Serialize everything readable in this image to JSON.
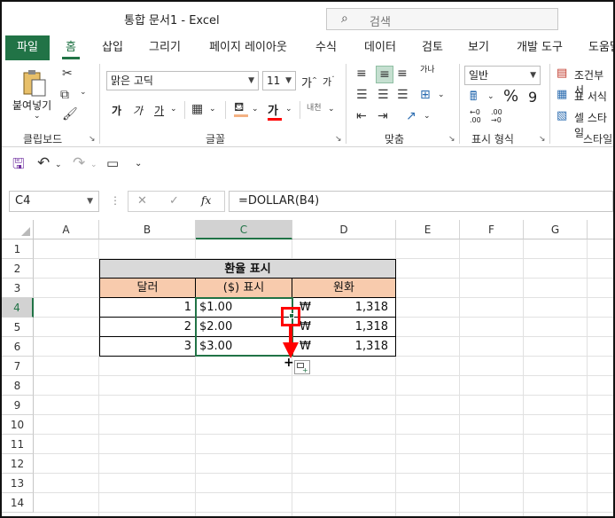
{
  "window": {
    "title": "통합 문서1  -  Excel",
    "search_placeholder": "검색"
  },
  "tabs": [
    {
      "label": "파일"
    },
    {
      "label": "홈"
    },
    {
      "label": "삽입"
    },
    {
      "label": "그리기"
    },
    {
      "label": "페이지 레이아웃"
    },
    {
      "label": "수식"
    },
    {
      "label": "데이터"
    },
    {
      "label": "검토"
    },
    {
      "label": "보기"
    },
    {
      "label": "개발 도구"
    },
    {
      "label": "도움말"
    }
  ],
  "ribbon": {
    "clipboard": {
      "paste_label": "붙여넣기",
      "group_label": "클립보드"
    },
    "font": {
      "font_name": "맑은 고딕",
      "font_size": "11",
      "grow_label": "가",
      "shrink_label": "가",
      "bold_label": "가",
      "italic_label": "가",
      "underline_label": "가",
      "font_color_label": "가",
      "phonetic_label": "내천",
      "group_label": "글꼴"
    },
    "alignment": {
      "wrap_label": "가나",
      "group_label": "맞춤"
    },
    "number": {
      "format": "일반",
      "percent": "%",
      "comma": "9",
      "group_label": "표시 형식"
    },
    "styles": {
      "conditional": "조건부 서",
      "table": "표 서식",
      "cell": "셀 스타일",
      "group_label": "스타일"
    }
  },
  "formula_bar": {
    "name_box": "C4",
    "cancel": "✕",
    "enter": "✓",
    "fx": "fx",
    "formula": "=DOLLAR(B4)"
  },
  "sheet": {
    "columns": [
      "A",
      "B",
      "C",
      "D",
      "E",
      "F",
      "G"
    ],
    "rows": [
      "1",
      "2",
      "3",
      "4",
      "5",
      "6",
      "7",
      "8",
      "9",
      "10",
      "11",
      "12",
      "13",
      "14"
    ],
    "selected_column": "C",
    "selected_row": "4",
    "table_title": "환율 표시",
    "headers": {
      "b": "달러",
      "c": "($) 표시",
      "d": "원화"
    },
    "data": [
      {
        "b": "1",
        "c": "$1.00",
        "currency": "₩",
        "d": "1,318"
      },
      {
        "b": "2",
        "c": "$2.00",
        "currency": "₩",
        "d": "1,318"
      },
      {
        "b": "3",
        "c": "$3.00",
        "currency": "₩",
        "d": "1,318"
      }
    ]
  },
  "colors": {
    "excel_green": "#217346",
    "title_fill": "#d9d9d9",
    "header_fill": "#f8cbad",
    "annotation_red": "#ff0000"
  }
}
